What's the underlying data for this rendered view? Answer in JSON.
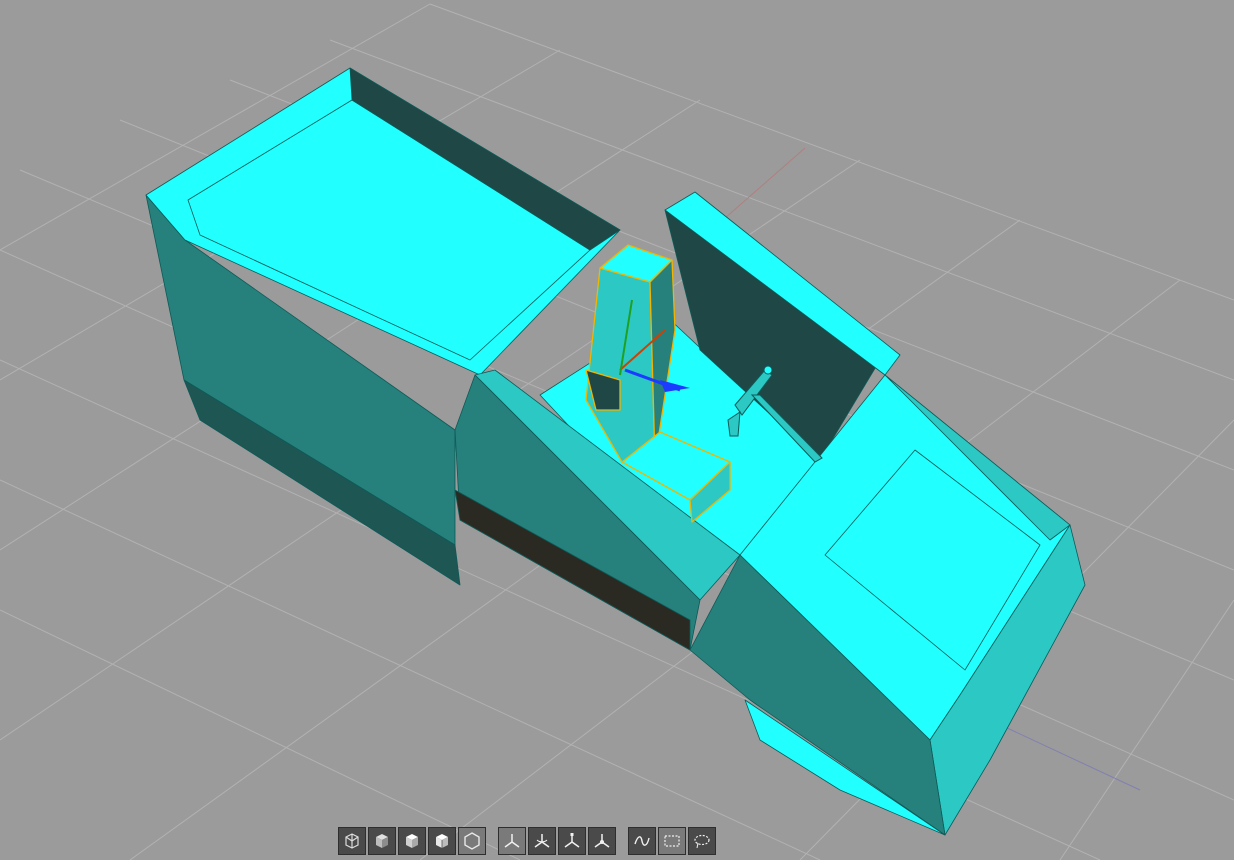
{
  "colors": {
    "background": "#9b9b9b",
    "grid": "#b4b4b4",
    "mesh_light": "#22ffff",
    "mesh_mid": "#2bc8c4",
    "mesh_dark": "#26807b",
    "mesh_shadow": "#1e4745",
    "selection": "#f2b400",
    "toolbar_button": "#4a4a4a"
  },
  "toolbar": {
    "groups": [
      {
        "name": "shading-modes",
        "buttons": [
          {
            "icon": "wireframe-cube-icon",
            "active": false
          },
          {
            "icon": "flat-cube-icon",
            "active": false
          },
          {
            "icon": "solid-cube-icon",
            "active": false
          },
          {
            "icon": "textured-cube-icon",
            "active": false
          },
          {
            "icon": "hexagon-icon",
            "active": true
          }
        ]
      },
      {
        "name": "transform-gizmos",
        "buttons": [
          {
            "icon": "axis-translate-icon",
            "active": true
          },
          {
            "icon": "axis-rotate-icon",
            "active": false
          },
          {
            "icon": "axis-scale-icon",
            "active": false
          },
          {
            "icon": "axis-universal-icon",
            "active": false
          }
        ]
      },
      {
        "name": "selection-modes",
        "buttons": [
          {
            "icon": "curve-select-icon",
            "active": false
          },
          {
            "icon": "rect-select-icon",
            "active": true
          },
          {
            "icon": "lasso-select-icon",
            "active": false
          }
        ]
      }
    ]
  }
}
